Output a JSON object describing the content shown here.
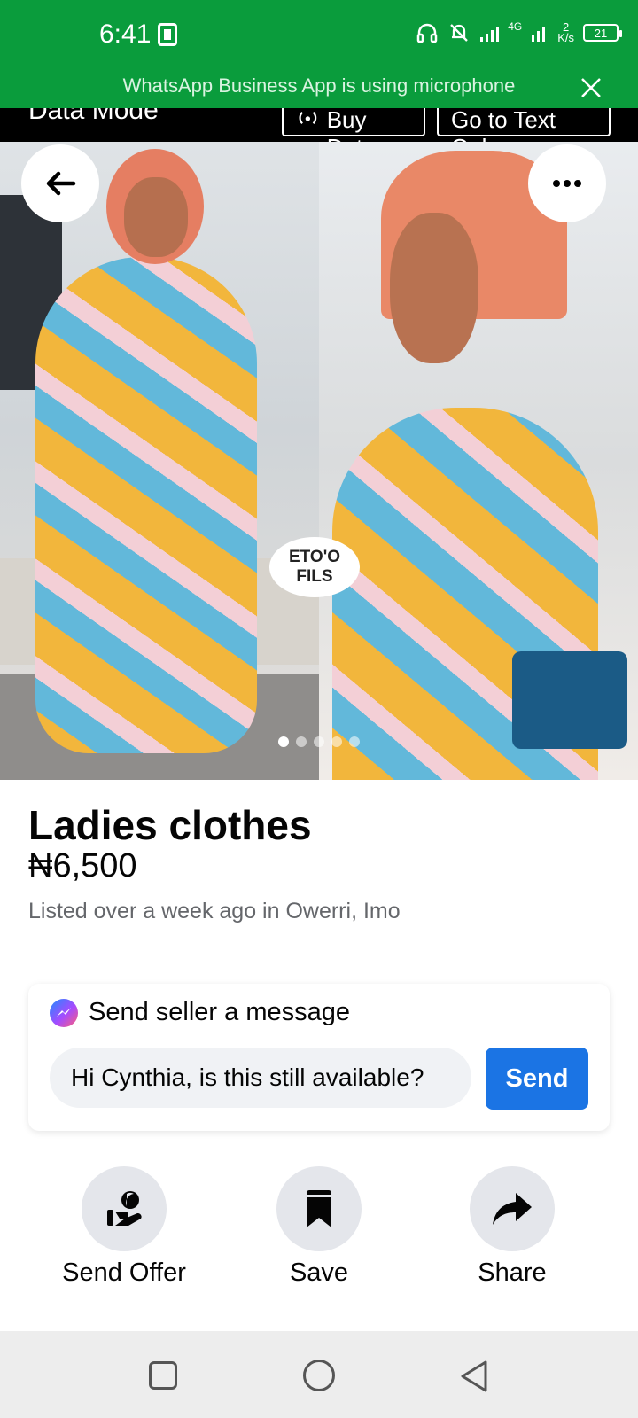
{
  "status_bar": {
    "time": "6:41",
    "network": "4G",
    "speed_value": "2",
    "speed_unit": "K/s",
    "battery": "21",
    "icons": [
      "sim-icon",
      "headphones-icon",
      "mute-icon",
      "signal-icon",
      "battery-icon"
    ]
  },
  "notice": {
    "text": "WhatsApp Business App is using microphone",
    "close_icon": "close-icon"
  },
  "data_bar": {
    "title": "Data Mode",
    "buy_label": "Buy Data",
    "text_only_label": "Go to Text Only"
  },
  "photo": {
    "watermark_line1": "ETO'O",
    "watermark_line2": "FILS",
    "slide_count": 5,
    "active_slide": 1
  },
  "listing": {
    "title": "Ladies clothes",
    "price": "₦6,500",
    "meta": "Listed over a week ago in Owerri, Imo"
  },
  "message": {
    "heading": "Send seller a message",
    "input_value": "Hi Cynthia, is this still available?",
    "send_label": "Send"
  },
  "actions": [
    {
      "label": "Send Offer",
      "icon": "offer-icon"
    },
    {
      "label": "Save",
      "icon": "bookmark-icon"
    },
    {
      "label": "Share",
      "icon": "share-icon"
    }
  ],
  "colors": {
    "status_green": "#0a9c3c",
    "send_blue": "#1b74e4",
    "action_grey": "#e4e6eb"
  }
}
